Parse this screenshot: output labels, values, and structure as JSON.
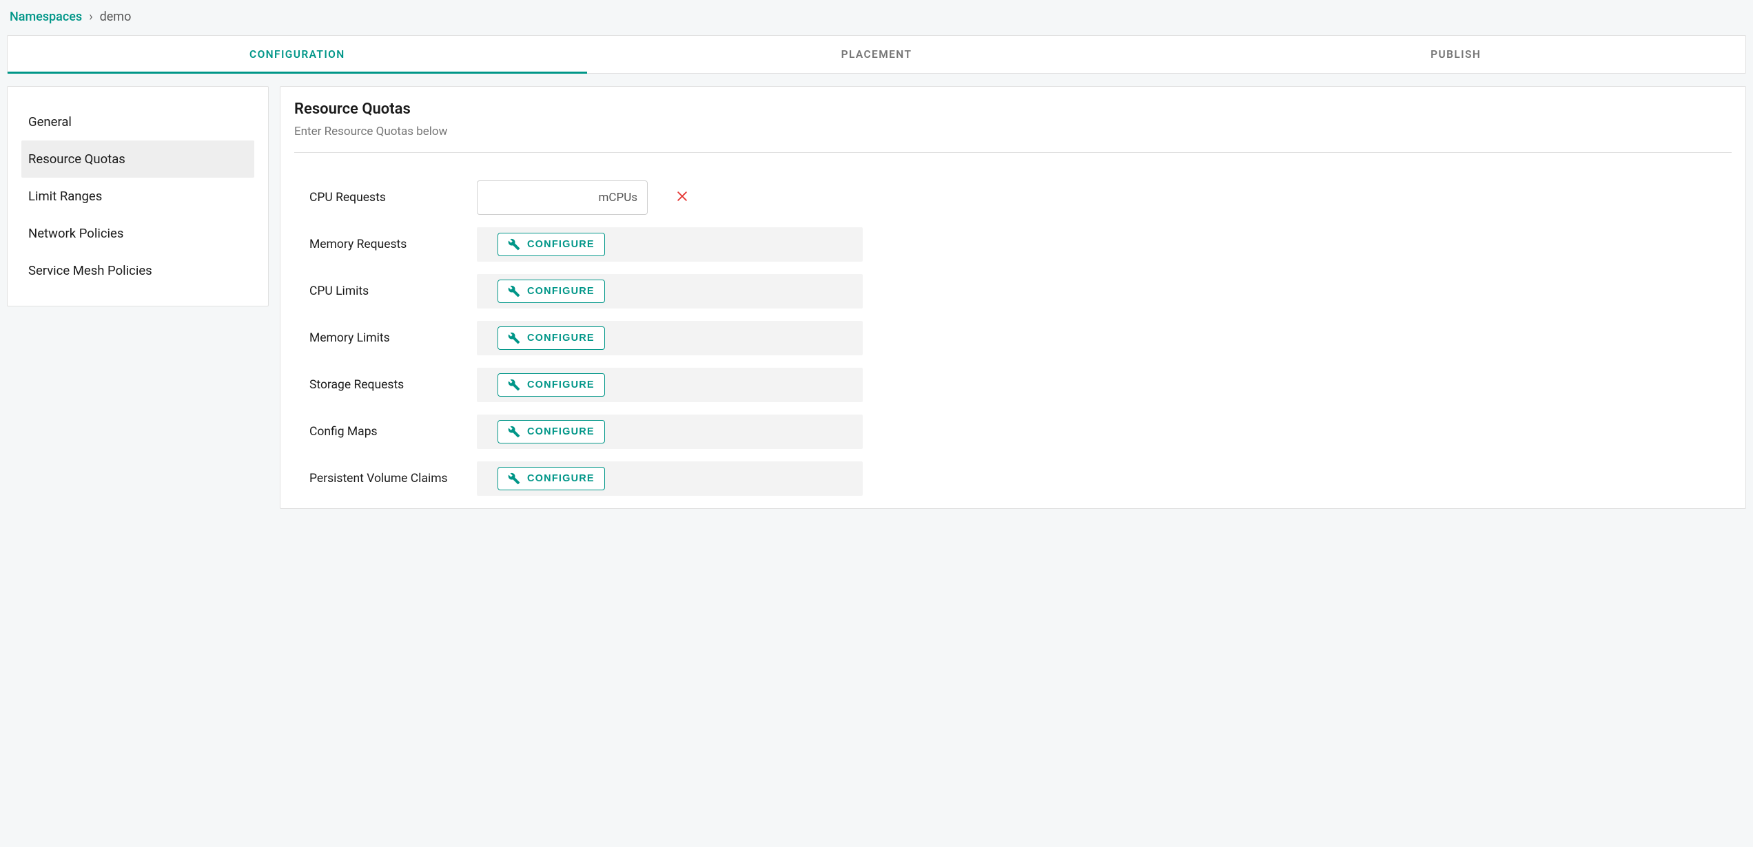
{
  "breadcrumb": {
    "root": "Namespaces",
    "separator": "›",
    "current": "demo"
  },
  "tabs": [
    {
      "label": "CONFIGURATION",
      "active": true
    },
    {
      "label": "PLACEMENT",
      "active": false
    },
    {
      "label": "PUBLISH",
      "active": false
    }
  ],
  "sidebar": {
    "items": [
      {
        "label": "General",
        "active": false
      },
      {
        "label": "Resource Quotas",
        "active": true
      },
      {
        "label": "Limit Ranges",
        "active": false
      },
      {
        "label": "Network Policies",
        "active": false
      },
      {
        "label": "Service Mesh Policies",
        "active": false
      }
    ]
  },
  "panel": {
    "title": "Resource Quotas",
    "subtitle": "Enter Resource Quotas below"
  },
  "cpu_requests": {
    "label": "CPU Requests",
    "value": "",
    "unit": "mCPUs"
  },
  "configure_label": "CONFIGURE",
  "quota_rows": [
    {
      "label": "Memory Requests",
      "name": "memory-requests"
    },
    {
      "label": "CPU Limits",
      "name": "cpu-limits"
    },
    {
      "label": "Memory Limits",
      "name": "memory-limits"
    },
    {
      "label": "Storage Requests",
      "name": "storage-requests"
    },
    {
      "label": "Config Maps",
      "name": "config-maps"
    },
    {
      "label": "Persistent Volume Claims",
      "name": "persistent-volume-claims"
    }
  ]
}
